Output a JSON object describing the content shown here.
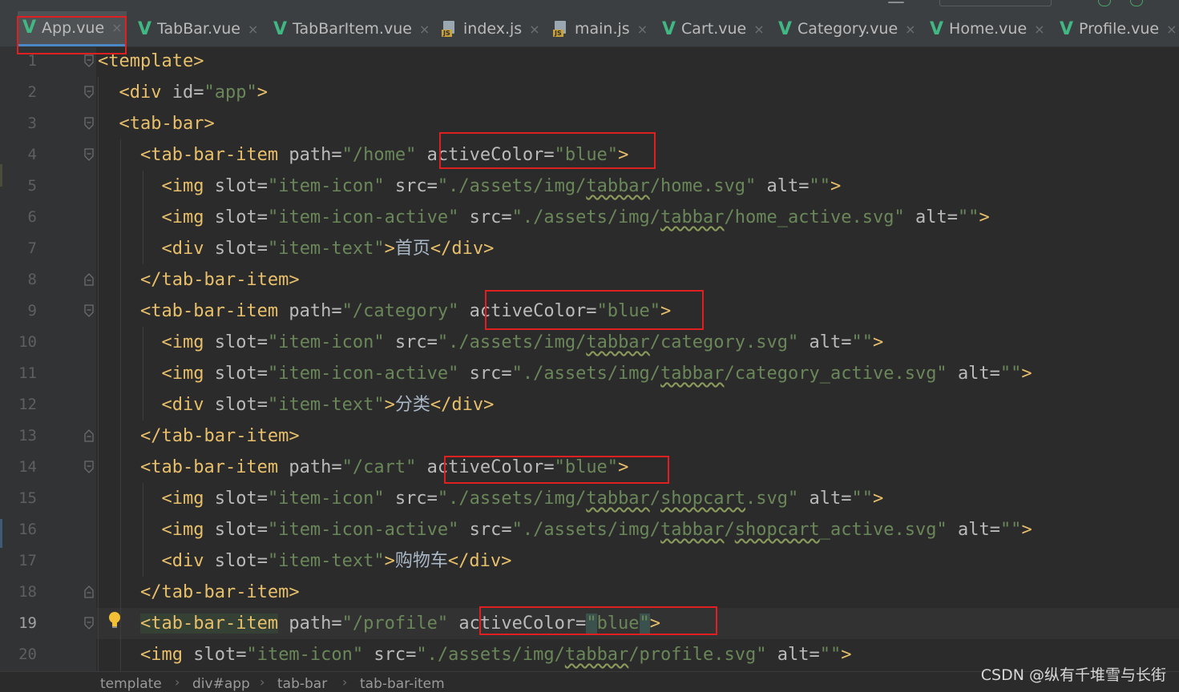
{
  "tabs": [
    {
      "label": "App.vue",
      "icon": "vue-icon",
      "active": true
    },
    {
      "label": "TabBar.vue",
      "icon": "vue-icon"
    },
    {
      "label": "TabBarItem.vue",
      "icon": "vue-icon"
    },
    {
      "label": "index.js",
      "icon": "js-file-icon"
    },
    {
      "label": "main.js",
      "icon": "js-file-icon"
    },
    {
      "label": "Cart.vue",
      "icon": "vue-icon"
    },
    {
      "label": "Category.vue",
      "icon": "vue-icon"
    },
    {
      "label": "Home.vue",
      "icon": "vue-icon"
    },
    {
      "label": "Profile.vue",
      "icon": "vue-icon"
    }
  ],
  "tab_close_glyph": "×",
  "line_numbers": [
    "1",
    "2",
    "3",
    "4",
    "5",
    "6",
    "7",
    "8",
    "9",
    "10",
    "11",
    "12",
    "13",
    "14",
    "15",
    "16",
    "17",
    "18",
    "19",
    "20"
  ],
  "current_line": "19",
  "code": {
    "l1": {
      "t1": "<template>"
    },
    "l2": {
      "t1": "<div ",
      "a1": "id=",
      "s1": "\"app\"",
      "t2": ">"
    },
    "l3": {
      "t1": "<tab-bar>"
    },
    "l4": {
      "t1": "<tab-bar-item ",
      "a1": "path=",
      "s1": "\"/home\"",
      "a2": "activeColor=",
      "s2": "\"blue\"",
      "t2": ">"
    },
    "l5": {
      "t1": "<img ",
      "a1": "slot=",
      "s1": "\"item-icon\"",
      "a2": "src=",
      "s2a": "\"./assets/img/",
      "s2b": "tabbar",
      "s2c": "/home.svg\"",
      "a3": "alt=",
      "s3": "\"\"",
      "t2": ">"
    },
    "l6": {
      "t1": "<img ",
      "a1": "slot=",
      "s1": "\"item-icon-active\"",
      "a2": "src=",
      "s2a": "\"./assets/img/",
      "s2b": "tabbar",
      "s2c": "/home_active.svg\"",
      "a3": "alt=",
      "s3": "\"\"",
      "t2": ">"
    },
    "l7": {
      "t1": "<div ",
      "a1": "slot=",
      "s1": "\"item-text\"",
      "t2": ">",
      "x": "首页",
      "t3": "</div>"
    },
    "l8": {
      "t1": "</tab-bar-item>"
    },
    "l9": {
      "t1": "<tab-bar-item ",
      "a1": "path=",
      "s1": "\"/category\"",
      "a2": "activeColor=",
      "s2": "\"blue\"",
      "t2": ">"
    },
    "l10": {
      "t1": "<img ",
      "a1": "slot=",
      "s1": "\"item-icon\"",
      "a2": "src=",
      "s2a": "\"./assets/img/",
      "s2b": "tabbar",
      "s2c": "/category.svg\"",
      "a3": "alt=",
      "s3": "\"\"",
      "t2": ">"
    },
    "l11": {
      "t1": "<img ",
      "a1": "slot=",
      "s1": "\"item-icon-active\"",
      "a2": "src=",
      "s2a": "\"./assets/img/",
      "s2b": "tabbar",
      "s2c": "/category_active.svg\"",
      "a3": "alt=",
      "s3": "\"\"",
      "t2": ">"
    },
    "l12": {
      "t1": "<div ",
      "a1": "slot=",
      "s1": "\"item-text\"",
      "t2": ">",
      "x": "分类",
      "t3": "</div>"
    },
    "l13": {
      "t1": "</tab-bar-item>"
    },
    "l14": {
      "t1": "<tab-bar-item ",
      "a1": "path=",
      "s1": "\"/cart\"",
      "a2": "activeColor=",
      "s2": "\"blue\"",
      "t2": ">"
    },
    "l15": {
      "t1": "<img ",
      "a1": "slot=",
      "s1": "\"item-icon\"",
      "a2": "src=",
      "s2a": "\"./assets/img/",
      "s2b": "tabbar",
      "s2m": "/",
      "s2d": "shopcart",
      "s2c": ".svg\"",
      "a3": "alt=",
      "s3": "\"\"",
      "t2": ">"
    },
    "l16": {
      "t1": "<img ",
      "a1": "slot=",
      "s1": "\"item-icon-active\"",
      "a2": "src=",
      "s2a": "\"./assets/img/",
      "s2b": "tabbar",
      "s2m": "/",
      "s2d": "shopcart",
      "s2c": "_active.svg\"",
      "a3": "alt=",
      "s3": "\"\"",
      "t2": ">"
    },
    "l17": {
      "t1": "<div ",
      "a1": "slot=",
      "s1": "\"item-text\"",
      "t2": ">",
      "x": "购物车",
      "t3": "</div>"
    },
    "l18": {
      "t1": "</tab-bar-item>"
    },
    "l19": {
      "t1": "<tab-bar-item",
      "a1": "path=",
      "s1": "\"/profile\"",
      "a2": "activeColor=",
      "q1": "\"",
      "s2": "blue",
      "q2": "\"",
      "t2": ">"
    },
    "l20": {
      "t1": "<img ",
      "a1": "slot=",
      "s1": "\"item-icon\"",
      "a2": "src=",
      "s2a": "\"./assets/img/",
      "s2b": "tabbar",
      "s2c": "/profile.svg\"",
      "a3": "alt=",
      "s3": "\"\"",
      "t2": ">"
    }
  },
  "breadcrumb": [
    "template",
    "div#app",
    "tab-bar",
    "tab-bar-item"
  ],
  "breadcrumb_sep": "›",
  "watermark": "CSDN @纵有千堆雪与长街",
  "colors": {
    "highlight_box": "#e02020",
    "vue_green": "#41b883",
    "tag": "#e8bf6a",
    "string": "#6a8759",
    "attribute": "#bababa"
  }
}
